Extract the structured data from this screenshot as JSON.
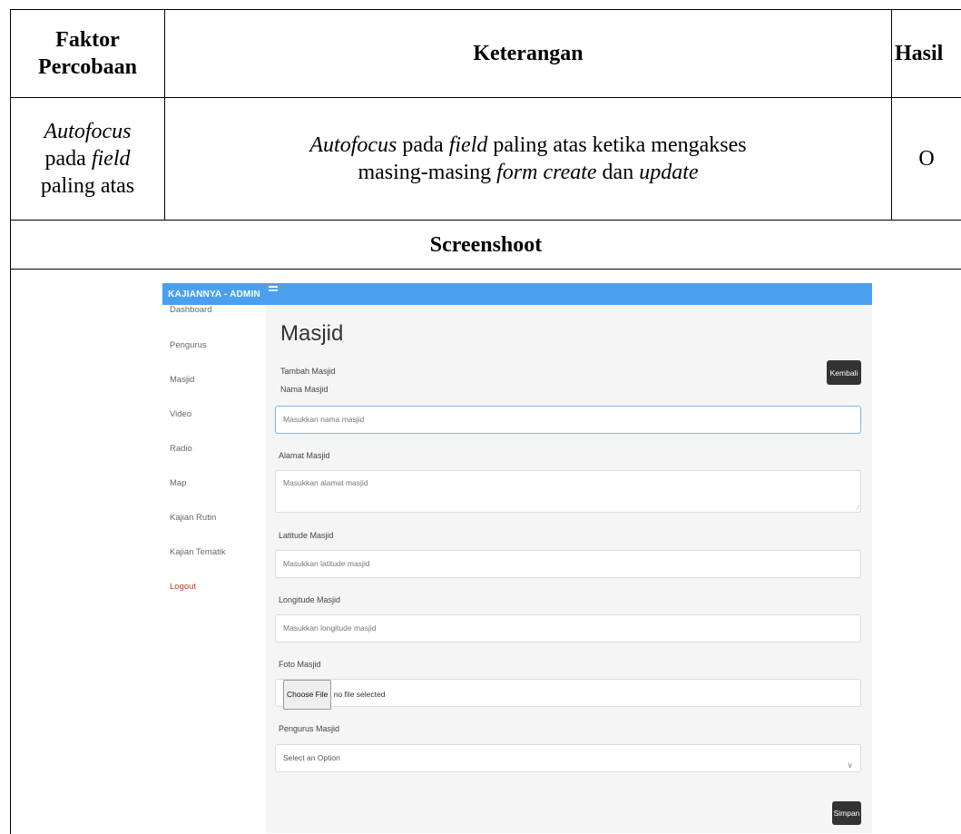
{
  "table": {
    "headers": {
      "faktor_line1": "Faktor",
      "faktor_line2": "Percobaan",
      "keterangan": "Keterangan",
      "hasil": "Hasil"
    },
    "row": {
      "faktor": {
        "a": "Autofocus",
        "b": "pada ",
        "c": "field",
        "d": "paling atas"
      },
      "keterangan": {
        "p1": "Autofocus",
        "p2": " pada ",
        "p3": "field",
        "p4": " paling atas ketika mengakses",
        "p5": "masing-masing ",
        "p6": "form create",
        "p7": " dan ",
        "p8": "update"
      },
      "hasil": "O"
    },
    "screenshot_header": "Screenshoot"
  },
  "screenshot": {
    "brand": "KAJIANNYA - ADMIN",
    "sidebar": [
      "Dashboard",
      "Pengurus",
      "Masjid",
      "Video",
      "Radio",
      "Map",
      "Kajian Rutin",
      "Kajian Tematik",
      "Logout"
    ],
    "page_title": "Masjid",
    "subtitle": "Tambah Masjid",
    "kembali": "Kembali",
    "fields": {
      "nama_label": "Nama Masjid",
      "nama_placeholder": "Masukkan nama masjid",
      "alamat_label": "Alamat Masjid",
      "alamat_placeholder": "Masukkan alamat masjid",
      "lat_label": "Latitude Masjid",
      "lat_placeholder": "Masukkan latitude masjid",
      "long_label": "Longitude Masjid",
      "long_placeholder": "Masukkan longitude masjid",
      "foto_label": "Foto Masjid",
      "choose_file": "Choose File",
      "no_file": "no file selected",
      "pengurus_label": "Pengurus Masjid",
      "select_placeholder": "Select an Option"
    },
    "simpan": "Simpan"
  }
}
